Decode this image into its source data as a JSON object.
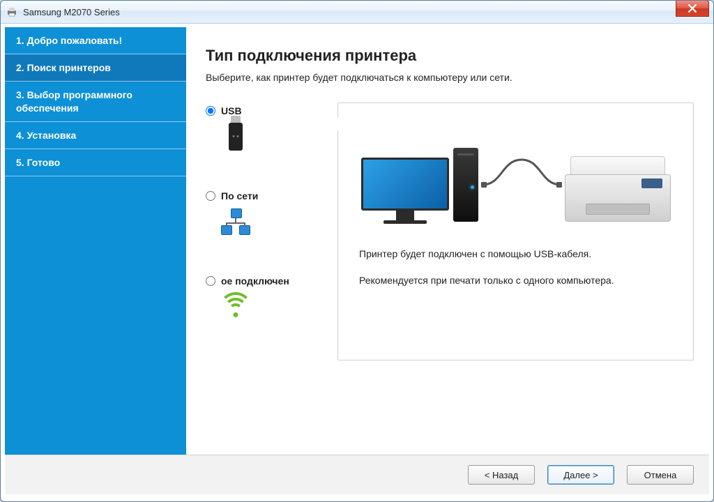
{
  "window": {
    "title": "Samsung M2070 Series"
  },
  "sidebar": {
    "steps": [
      {
        "label": "1. Добро пожаловать!"
      },
      {
        "label": "2. Поиск принтеров"
      },
      {
        "label": "3. Выбор программного обеспечения"
      },
      {
        "label": "4. Установка"
      },
      {
        "label": "5. Готово"
      }
    ],
    "active_index": 1
  },
  "main": {
    "heading": "Тип подключения принтера",
    "subheading": "Выберите, как принтер будет подключаться к компьютеру или сети.",
    "options": {
      "usb": {
        "label": "USB",
        "selected": true
      },
      "network": {
        "label": "По сети",
        "selected": false
      },
      "wireless": {
        "label": "ое подключен",
        "selected": false
      }
    },
    "description": {
      "line1": "Принтер будет подключен с помощью USB-кабеля.",
      "line2": "Рекомендуется при печати только с одного компьютера."
    }
  },
  "buttons": {
    "back": "< Назад",
    "next": "Далее >",
    "cancel": "Отмена"
  },
  "icons": {
    "app": "printer-icon",
    "close": "close-icon",
    "usb": "usb-drive-icon",
    "network": "network-icon",
    "wireless": "wifi-icon"
  },
  "colors": {
    "sidebar": "#0d90d6",
    "sidebar_active": "#1079bb",
    "accent": "#2da1e8",
    "success": "#6fbf2a",
    "close": "#d9432b"
  }
}
